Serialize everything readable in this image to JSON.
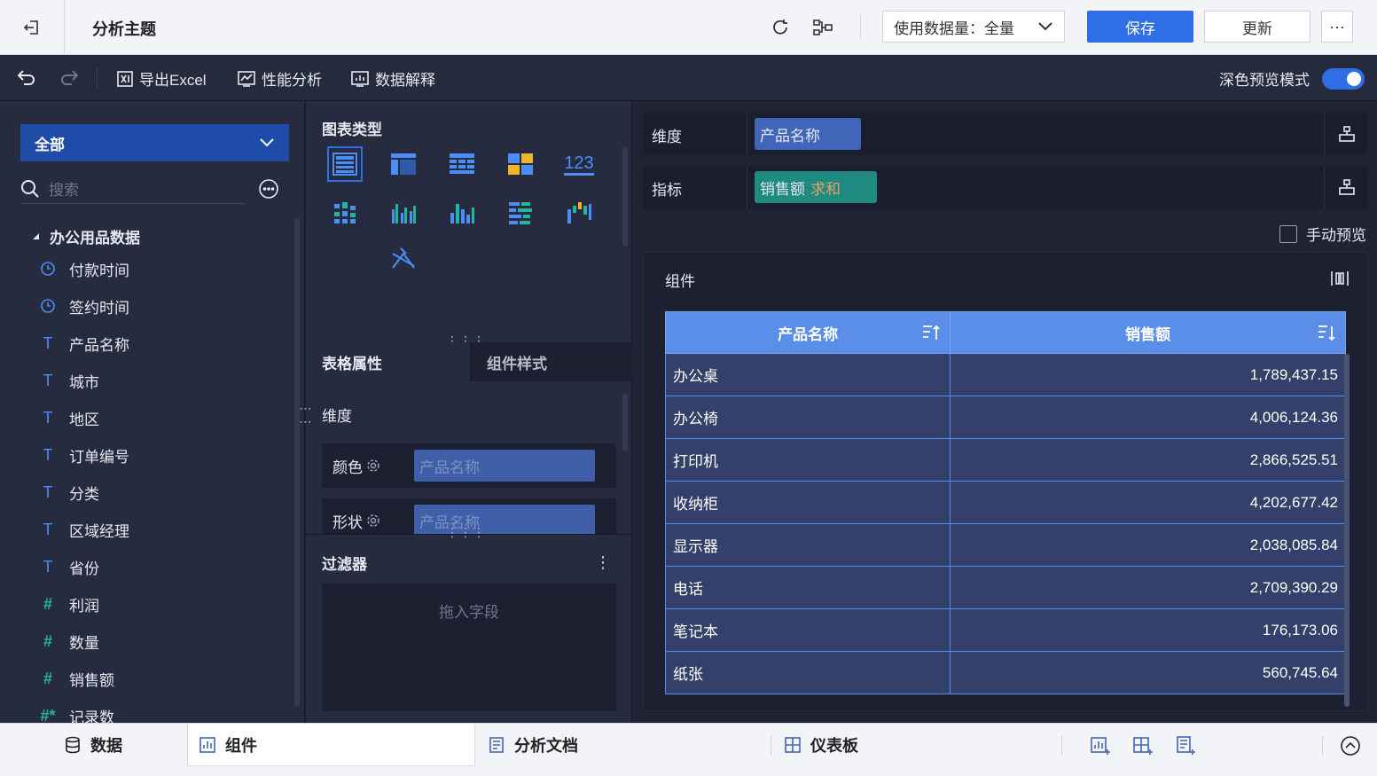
{
  "header": {
    "title": "分析主题",
    "data_usage_label": "使用数据量：全量",
    "save_label": "保存",
    "update_label": "更新",
    "more_label": "···"
  },
  "toolbar": {
    "export_label": "导出Excel",
    "performance_label": "性能分析",
    "explain_label": "数据解释",
    "dark_mode_label": "深色预览模式",
    "dark_mode_on": true
  },
  "left": {
    "scope_label": "全部",
    "search_placeholder": "搜索",
    "group_title": "办公用品数据",
    "fields": [
      {
        "type": "time",
        "label": "付款时间"
      },
      {
        "type": "time",
        "label": "签约时间"
      },
      {
        "type": "text",
        "label": "产品名称"
      },
      {
        "type": "text",
        "label": "城市"
      },
      {
        "type": "text",
        "label": "地区"
      },
      {
        "type": "text",
        "label": "订单编号"
      },
      {
        "type": "text",
        "label": "分类"
      },
      {
        "type": "text",
        "label": "区域经理"
      },
      {
        "type": "text",
        "label": "省份"
      },
      {
        "type": "number",
        "label": "利润"
      },
      {
        "type": "number",
        "label": "数量"
      },
      {
        "type": "number",
        "label": "销售额"
      },
      {
        "type": "number-star",
        "label": "记录数"
      }
    ]
  },
  "mid": {
    "chart_type_title": "图表类型",
    "number_chart_label": "123",
    "tab_table_props": "表格属性",
    "tab_component_style": "组件样式",
    "dimension_label": "维度",
    "color_label": "颜色",
    "color_value": "产品名称",
    "shape_label": "形状",
    "shape_value": "产品名称",
    "filter_title": "过滤器",
    "filter_placeholder": "拖入字段"
  },
  "right": {
    "dimension_label": "维度",
    "dimension_pill": "产品名称",
    "measure_label": "指标",
    "measure_pill": "销售额",
    "measure_agg": "求和",
    "manual_preview_label": "手动预览",
    "component_title": "组件",
    "table": {
      "columns": [
        "产品名称",
        "销售额"
      ],
      "rows": [
        [
          "办公桌",
          "1,789,437.15"
        ],
        [
          "办公椅",
          "4,006,124.36"
        ],
        [
          "打印机",
          "2,866,525.51"
        ],
        [
          "收纳柜",
          "4,202,677.42"
        ],
        [
          "显示器",
          "2,038,085.84"
        ],
        [
          "电话",
          "2,709,390.29"
        ],
        [
          "笔记本",
          "176,173.06"
        ],
        [
          "纸张",
          "560,745.64"
        ]
      ]
    }
  },
  "bottom": {
    "data_tab": "数据",
    "component_tab": "组件",
    "doc_tab": "分析文档",
    "dashboard_tab": "仪表板"
  },
  "colors": {
    "accent": "#2f6ee6",
    "measure_pill": "#1f8a80",
    "dimension_pill": "#3f66b8",
    "table_header": "#5b8ee8",
    "table_row": "#334069"
  }
}
